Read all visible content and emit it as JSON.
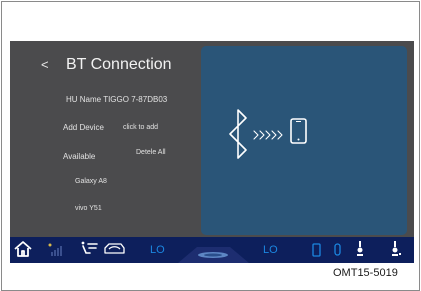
{
  "header": {
    "back_label": "<",
    "title": "BT Connection"
  },
  "device": {
    "hu_name_label": "HU Name TIGGO 7-87DB03"
  },
  "add_device": {
    "label": "Add Device",
    "action": "click to add"
  },
  "available": {
    "label": "Available",
    "delete_all": "Detele All"
  },
  "paired_devices": [
    "Galaxy A8",
    "vivo Y51"
  ],
  "right_panel": {
    "icons": [
      "bluetooth-icon",
      "chevrons-icon",
      "phone-icon"
    ]
  },
  "bottom_bar": {
    "left_temp": "LO",
    "right_temp": "LO",
    "icons": [
      "home-icon",
      "fan-speed-icon",
      "seat-airflow-icon",
      "car-recirculation-icon",
      "defrost-icon",
      "rear-defrost-icon",
      "seat-heat-left-icon",
      "seat-heat-right-icon"
    ]
  },
  "colors": {
    "screen_bg": "#4b4b4d",
    "panel_bg": "#2a5578",
    "bar_bg": "#0d1f5c",
    "accent": "#1b86e0"
  },
  "caption": "OMT15-5019"
}
